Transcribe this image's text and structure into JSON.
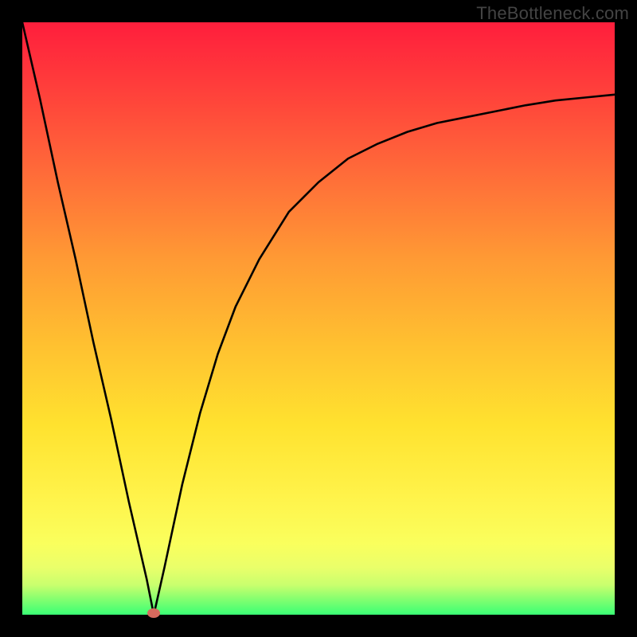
{
  "watermark": "TheBottleneck.com",
  "colors": {
    "frame": "#000000",
    "curve": "#000000",
    "marker": "#d66a5e"
  },
  "chart_data": {
    "type": "line",
    "title": "",
    "xlabel": "",
    "ylabel": "",
    "xlim": [
      0,
      100
    ],
    "ylim": [
      0,
      100
    ],
    "grid": false,
    "legend": false,
    "annotations": [
      "TheBottleneck.com"
    ],
    "series": [
      {
        "name": "bottleneck-curve",
        "x": [
          0,
          3,
          6,
          9,
          12,
          15,
          18,
          21,
          22.2,
          24,
          27,
          30,
          33,
          36,
          40,
          45,
          50,
          55,
          60,
          65,
          70,
          75,
          80,
          85,
          90,
          95,
          100
        ],
        "y": [
          100,
          87,
          73,
          60,
          46,
          33,
          19,
          6,
          0,
          8,
          22,
          34,
          44,
          52,
          60,
          68,
          73,
          77,
          79.5,
          81.5,
          83,
          84,
          85,
          86,
          86.8,
          87.3,
          87.8
        ]
      }
    ],
    "marker": {
      "x": 22.2,
      "y": 0
    },
    "background_gradient": {
      "top": "#ff1e3c",
      "mid": "#ffe22f",
      "bottom": "#3aff75"
    }
  }
}
